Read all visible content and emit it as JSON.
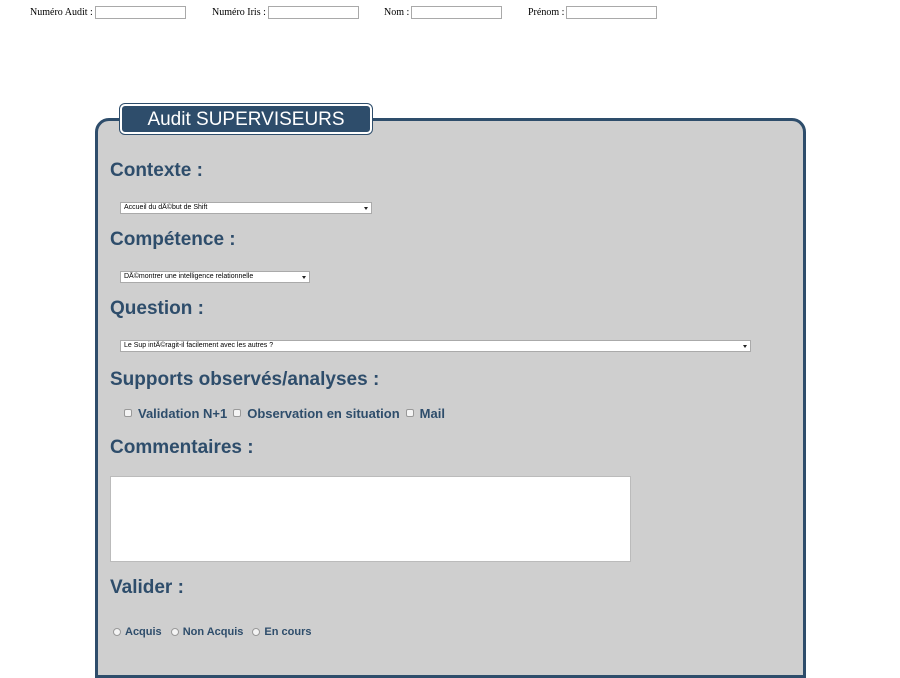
{
  "top_fields": {
    "audit_label": "Numéro Audit :",
    "audit_value": "",
    "iris_label": "Numéro Iris :",
    "iris_value": "",
    "nom_label": "Nom :",
    "nom_value": "",
    "prenom_label": "Prénom :",
    "prenom_value": ""
  },
  "panel": {
    "legend": "Audit SUPERVISEURS"
  },
  "contexte": {
    "heading": "Contexte :",
    "selected": "Accueil du dÃ©but de Shift"
  },
  "competence": {
    "heading": "Compétence :",
    "selected": "DÃ©montrer une intelligence relationnelle"
  },
  "question": {
    "heading": "Question :",
    "selected": "Le Sup intÃ©ragit-il facilement avec les autres ?"
  },
  "supports": {
    "heading": "Supports observés/analyses :",
    "options": [
      "Validation N+1",
      "Observation en situation",
      "Mail"
    ]
  },
  "commentaires": {
    "heading": "Commentaires :",
    "value": ""
  },
  "valider": {
    "heading": "Valider :",
    "options": [
      "Acquis",
      "Non Acquis",
      "En cours"
    ]
  },
  "colors": {
    "accent": "#2e4d6b",
    "panel_bg": "#cfcfcf"
  }
}
